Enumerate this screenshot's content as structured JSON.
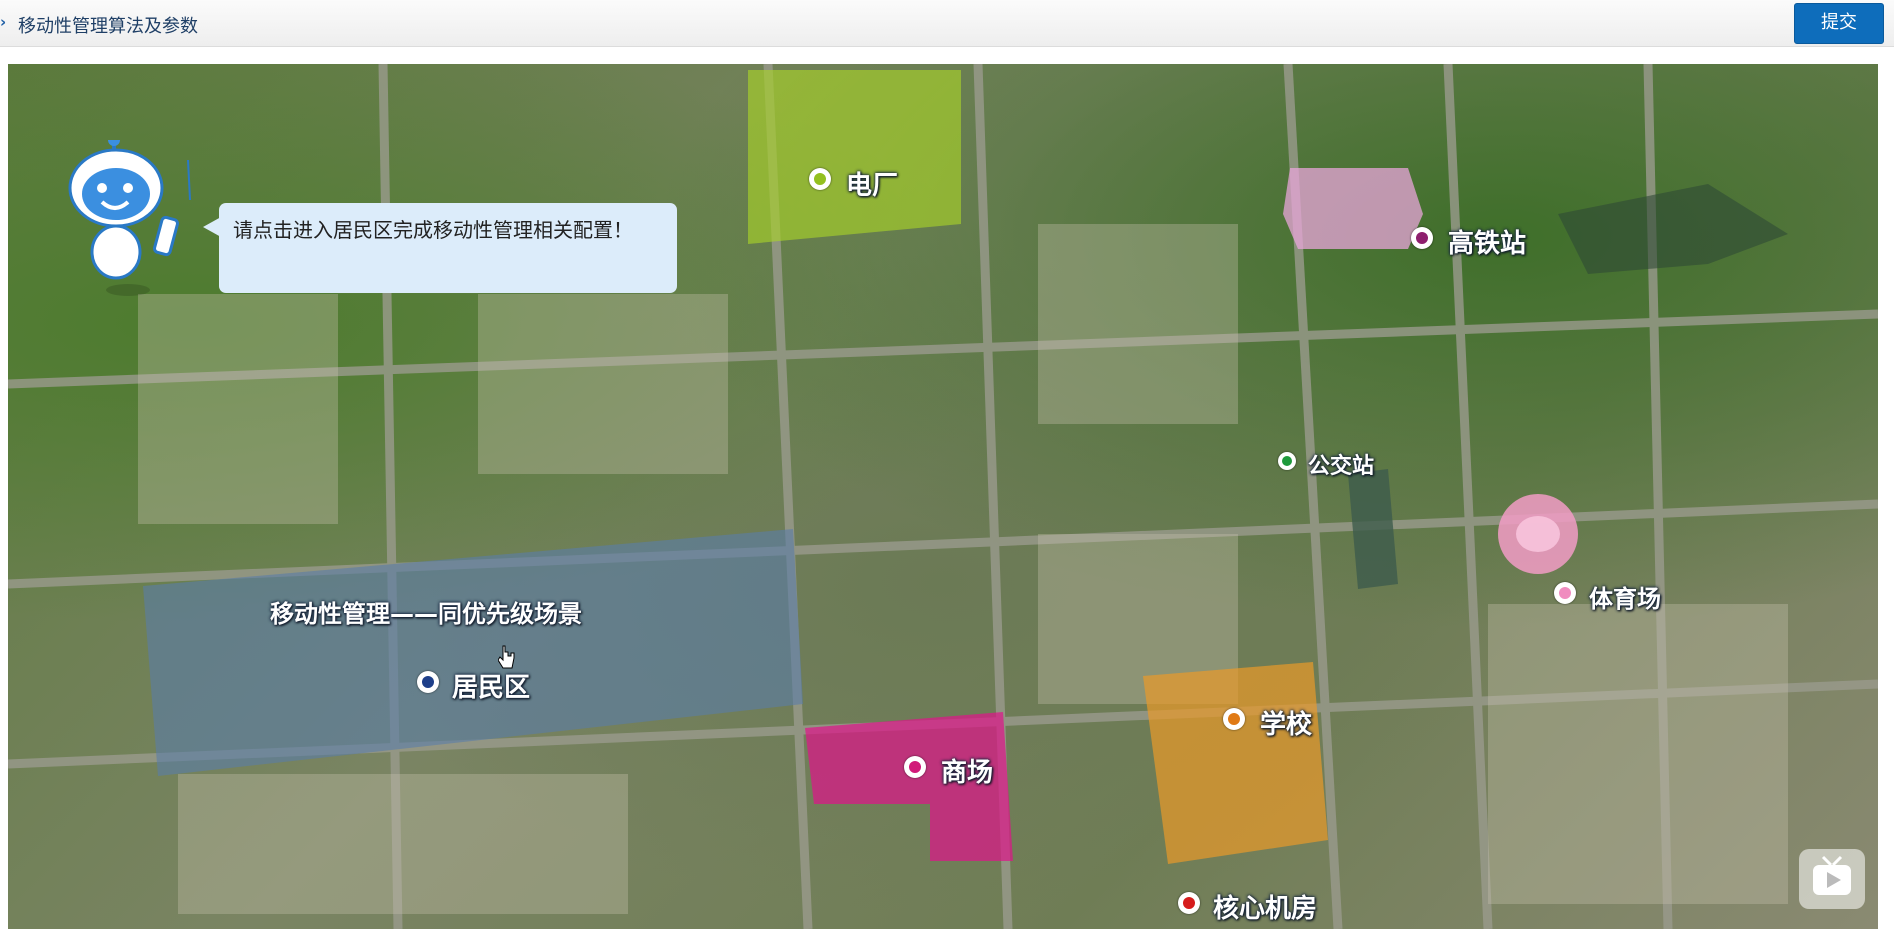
{
  "header": {
    "title": "移动性管理算法及参数",
    "submit_label": "提交"
  },
  "map": {
    "speech": "请点击进入居民区完成移动性管理相关配置！",
    "scenario_title": "移动性管理——同优先级场景",
    "locations": [
      {
        "label": "电厂",
        "color": "#93c01f"
      },
      {
        "label": "高铁站",
        "color": "#8e1f6e"
      },
      {
        "label": "公交站",
        "color": "#1e9a3c"
      },
      {
        "label": "体育场",
        "color": "#f08cbf"
      },
      {
        "label": "居民区",
        "color": "#1e3f8a"
      },
      {
        "label": "学校",
        "color": "#e07a16"
      },
      {
        "label": "商场",
        "color": "#d11a79"
      },
      {
        "label": "核心机房",
        "color": "#d61c1c"
      }
    ]
  },
  "icons": {
    "robot": "robot-mascot-icon",
    "play": "play-video-icon",
    "cursor": "mouse-cursor-icon"
  }
}
